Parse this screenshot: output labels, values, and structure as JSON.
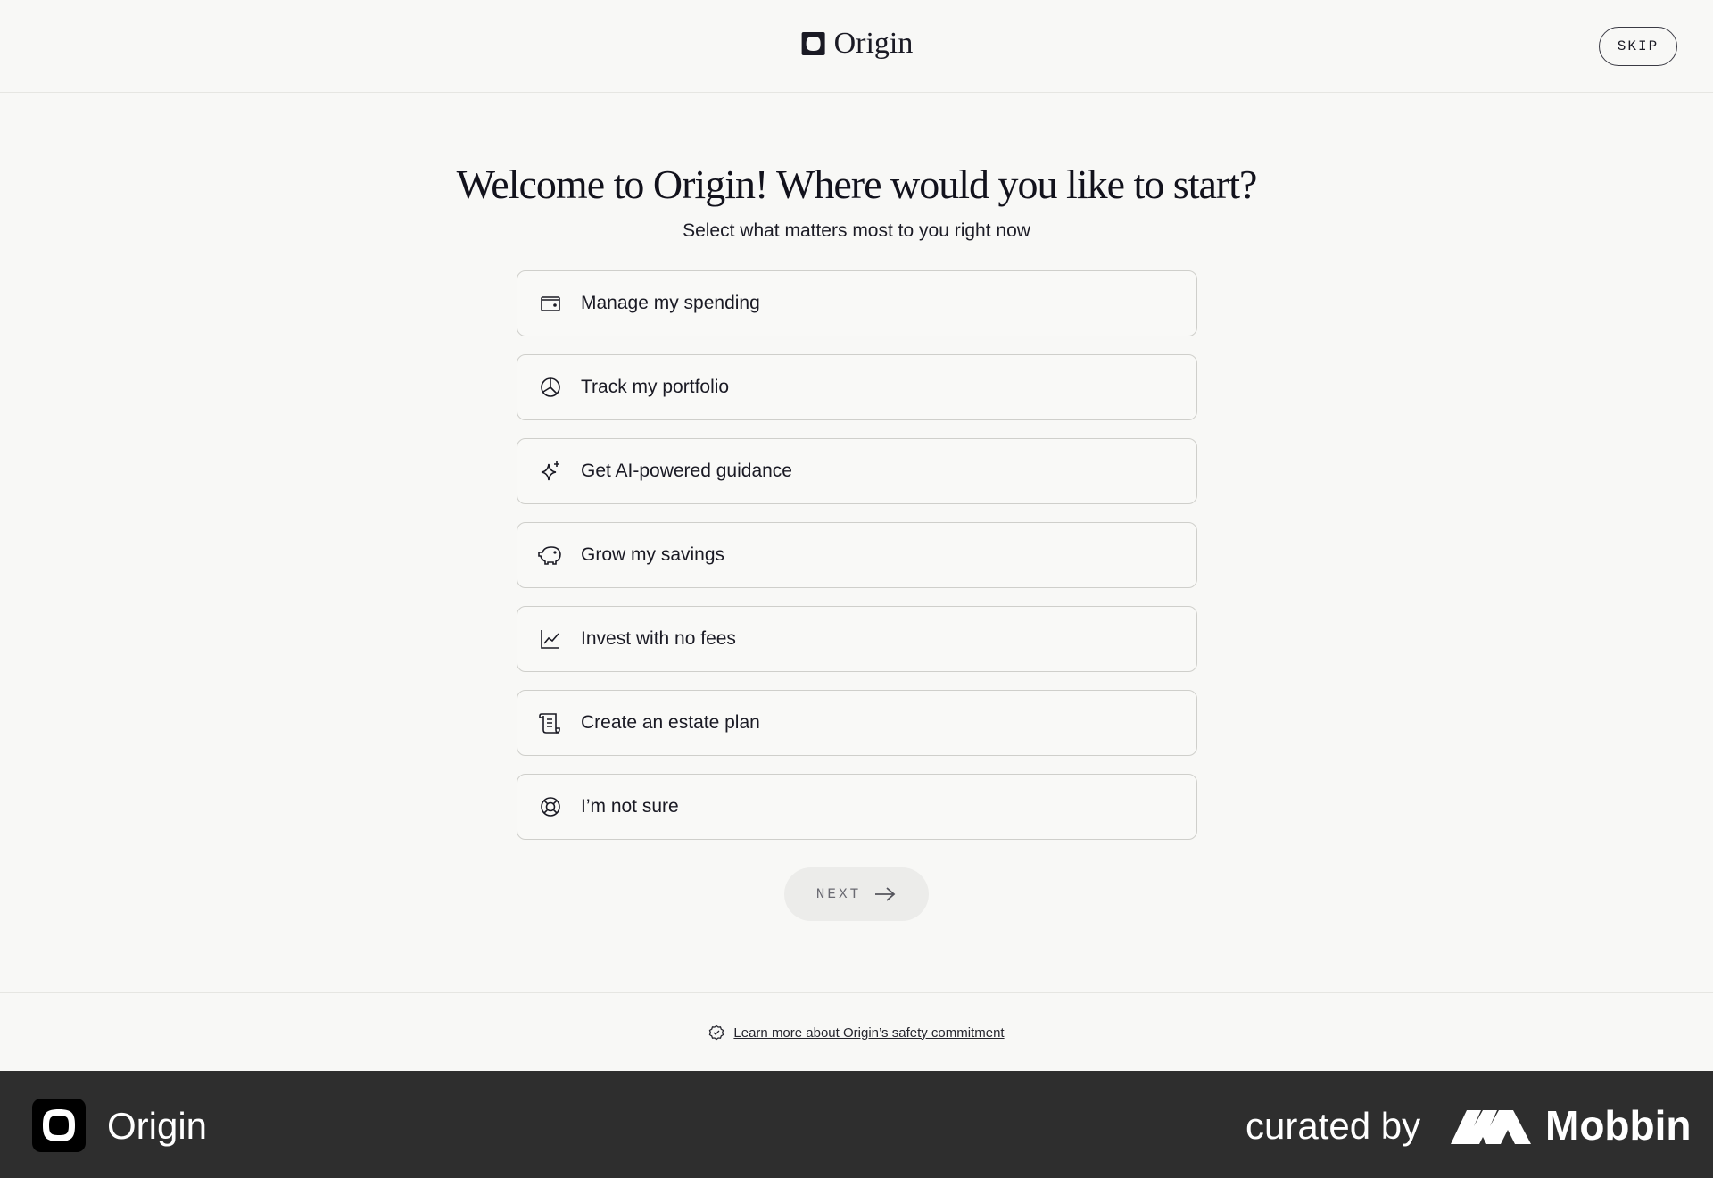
{
  "header": {
    "brand_name": "Origin",
    "skip_label": "SKIP"
  },
  "main": {
    "title": "Welcome to Origin! Where would you like to start?",
    "subtitle": "Select what matters most to you right now",
    "options": [
      {
        "label": "Manage my spending",
        "icon": "wallet-icon"
      },
      {
        "label": "Track my portfolio",
        "icon": "pie-chart-icon"
      },
      {
        "label": "Get AI-powered guidance",
        "icon": "sparkle-icon"
      },
      {
        "label": "Grow my savings",
        "icon": "piggy-bank-icon"
      },
      {
        "label": "Invest with no fees",
        "icon": "line-chart-icon"
      },
      {
        "label": "Create an estate plan",
        "icon": "scroll-icon"
      },
      {
        "label": "I’m not sure",
        "icon": "lifebuoy-icon"
      }
    ],
    "next_label": "NEXT"
  },
  "footer": {
    "safety_link": "Learn more about Origin’s safety commitment"
  },
  "watermark": {
    "app_name": "Origin",
    "curated_by": "curated by",
    "mobbin": "Mobbin"
  },
  "colors": {
    "background": "#f8f8f6",
    "text": "#15151f",
    "border": "#cfcfcb",
    "watermark_bg": "#2e2e2e"
  }
}
